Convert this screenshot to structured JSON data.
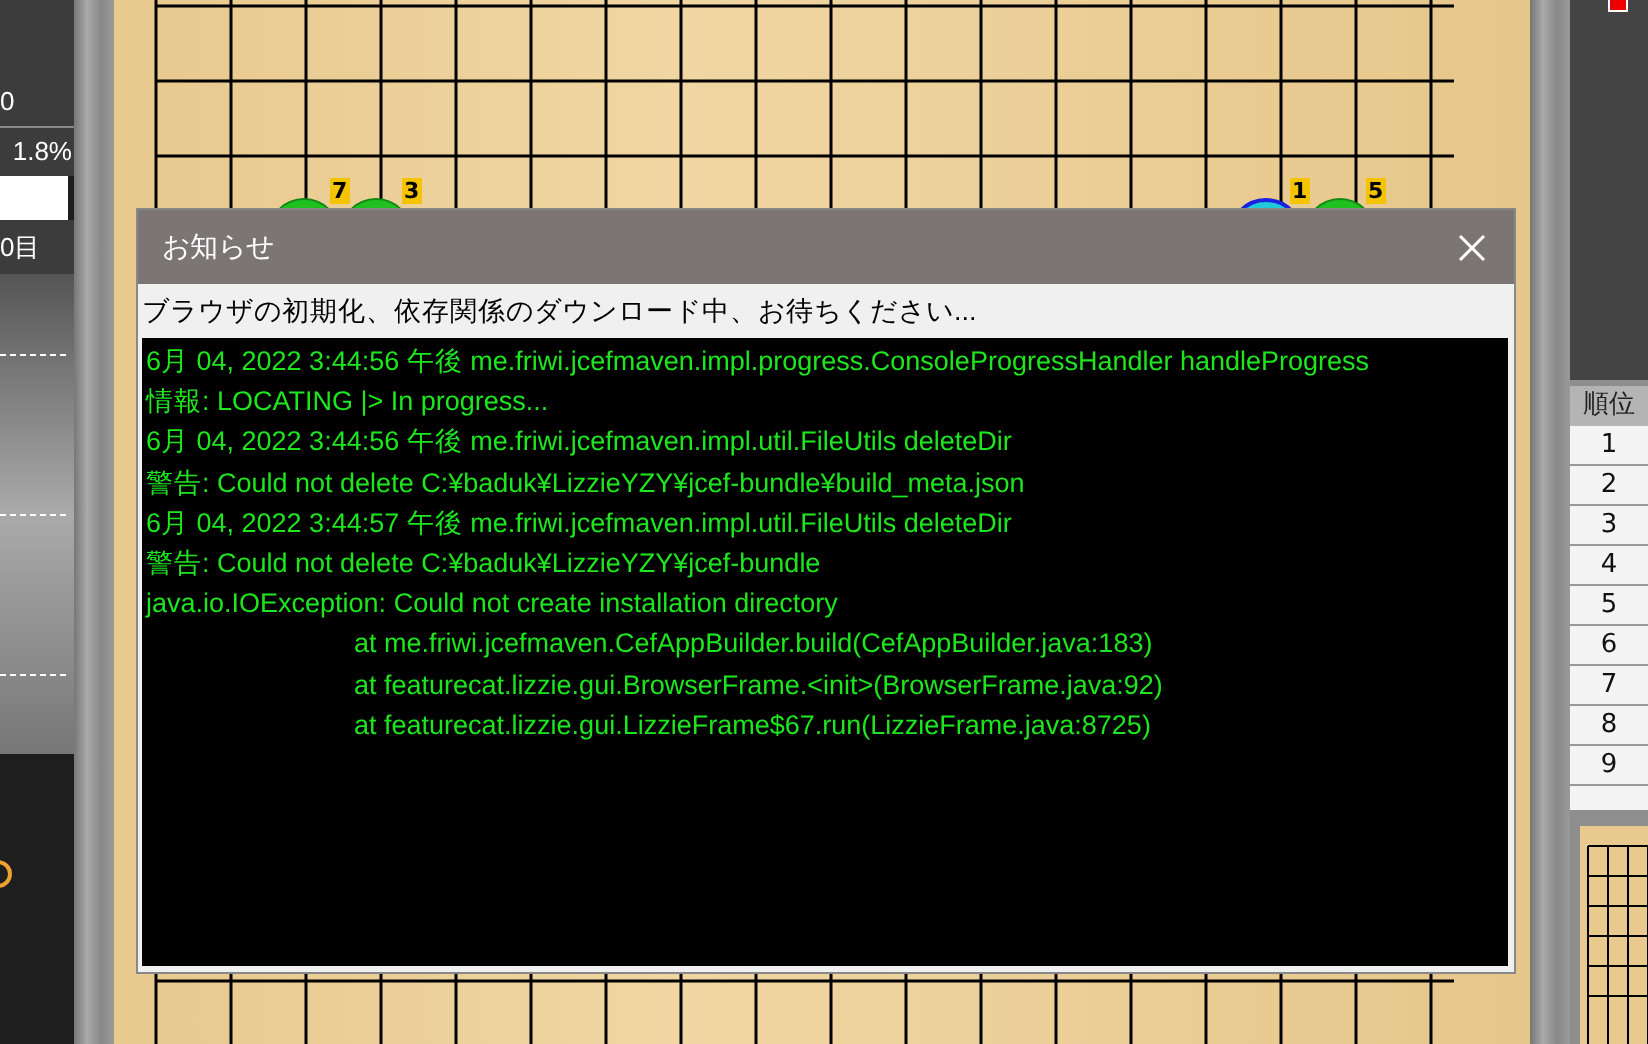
{
  "left_panel": {
    "value_1": "0",
    "win_rate": "1.8%",
    "score": "0目"
  },
  "board": {
    "stones": [
      {
        "kind": "green",
        "badge": "7"
      },
      {
        "kind": "green",
        "badge": "3"
      },
      {
        "kind": "blue",
        "badge": "1"
      },
      {
        "kind": "green",
        "badge": "5"
      }
    ]
  },
  "dialog": {
    "title": "お知らせ",
    "message": "ブラウザの初期化、依存関係のダウンロード中、お待ちください...",
    "log": [
      {
        "kind": "line",
        "text": "6月 04, 2022 3:44:56 午後 me.friwi.jcefmaven.impl.progress.ConsoleProgressHandler handleProgress"
      },
      {
        "kind": "line",
        "text": "情報: LOCATING |> In progress..."
      },
      {
        "kind": "line",
        "text": "6月 04, 2022 3:44:56 午後 me.friwi.jcefmaven.impl.util.FileUtils deleteDir"
      },
      {
        "kind": "line",
        "text": "警告: Could not delete C:¥baduk¥LizzieYZY¥jcef-bundle¥build_meta.json"
      },
      {
        "kind": "line",
        "text": "6月 04, 2022 3:44:57 午後 me.friwi.jcefmaven.impl.util.FileUtils deleteDir"
      },
      {
        "kind": "line",
        "text": "警告: Could not delete C:¥baduk¥LizzieYZY¥jcef-bundle"
      },
      {
        "kind": "line",
        "text": "java.io.IOException: Could not create installation directory"
      },
      {
        "kind": "stack",
        "text": "at me.friwi.jcefmaven.CefAppBuilder.build(CefAppBuilder.java:183)"
      },
      {
        "kind": "stack",
        "text": "at featurecat.lizzie.gui.BrowserFrame.<init>(BrowserFrame.java:92)"
      },
      {
        "kind": "stack",
        "text": "at featurecat.lizzie.gui.LizzieFrame$67.run(LizzieFrame.java:8725)"
      }
    ]
  },
  "rank_table": {
    "header": "順位",
    "rows": [
      "1",
      "2",
      "3",
      "4",
      "5",
      "6",
      "7",
      "8",
      "9"
    ]
  }
}
